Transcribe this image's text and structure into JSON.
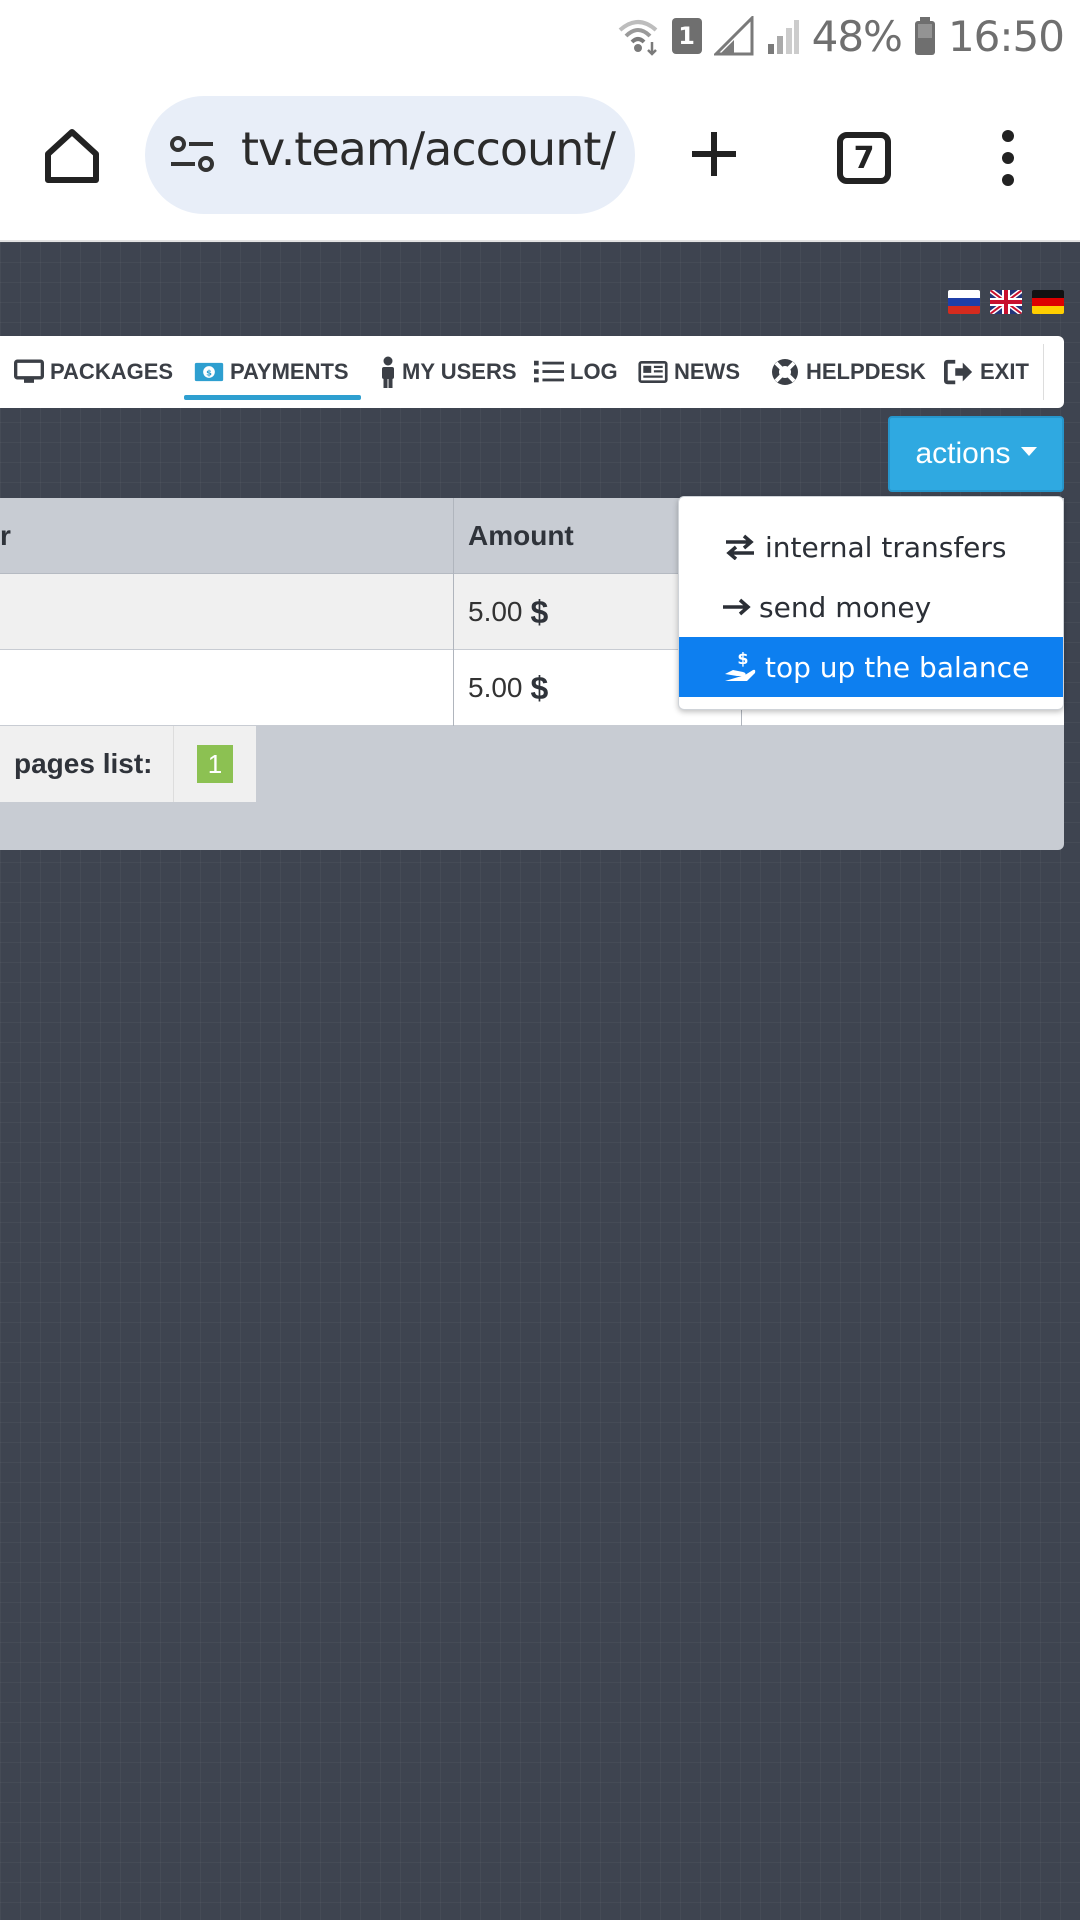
{
  "status_bar": {
    "sim_badge": "1",
    "battery": "48%",
    "time": "16:50"
  },
  "browser": {
    "url": "tv.team/account/",
    "tab_count": "7"
  },
  "nav": {
    "items": [
      {
        "label": "PACKAGES",
        "icon": "monitor-icon"
      },
      {
        "label": "PAYMENTS",
        "icon": "money-icon",
        "active": true
      },
      {
        "label": "MY USERS",
        "icon": "person-icon"
      },
      {
        "label": "LOG",
        "icon": "list-icon"
      },
      {
        "label": "NEWS",
        "icon": "newspaper-icon"
      },
      {
        "label": "HELPDESK",
        "icon": "lifebuoy-icon"
      },
      {
        "label": "EXIT",
        "icon": "sign-out-icon"
      }
    ]
  },
  "actions": {
    "label": "actions",
    "menu": [
      {
        "label": "internal transfers",
        "icon": "exchange-icon"
      },
      {
        "label": "send money",
        "icon": "arrow-right-icon"
      },
      {
        "label": "top up the balance",
        "icon": "hand-dollar-icon",
        "active": true
      }
    ]
  },
  "table": {
    "headers": [
      "r",
      "Amount"
    ],
    "rows": [
      {
        "amount": "5.00",
        "currency": "$"
      },
      {
        "amount": "5.00",
        "currency": "$"
      }
    ]
  },
  "pager": {
    "label": "pages list:",
    "current": "1"
  },
  "colors": {
    "accent": "#2fa9e1",
    "active_menu": "#0d7ff0",
    "page_bg": "#3e4450",
    "pager_green": "#8cc152"
  }
}
